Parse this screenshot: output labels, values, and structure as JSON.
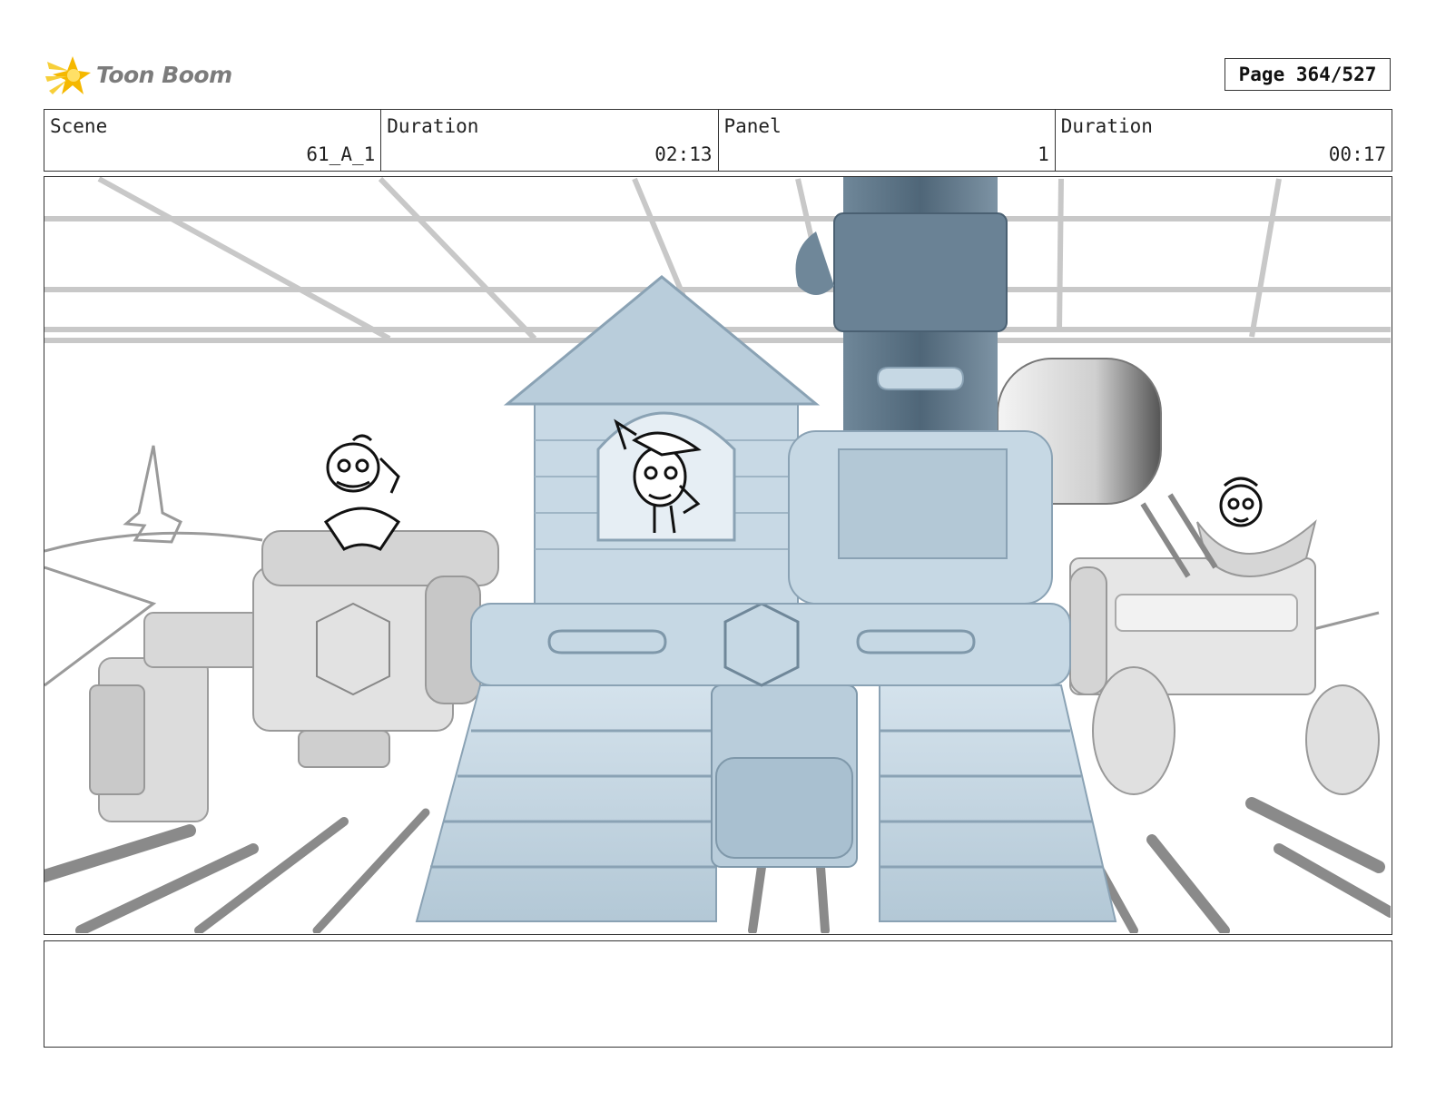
{
  "header": {
    "logo_text": "Toon Boom",
    "page_indicator": "Page 364/527"
  },
  "info": {
    "scene_label": "Scene",
    "scene_value": "61_A_1",
    "scene_duration_label": "Duration",
    "scene_duration_value": "02:13",
    "panel_label": "Panel",
    "panel_value": "1",
    "panel_duration_label": "Duration",
    "panel_duration_value": "00:17"
  },
  "notes": {
    "text": ""
  },
  "colors": {
    "vehicle_blue": "#c4d6e2",
    "vehicle_blue_dark": "#5b7385",
    "vehicle_gray": "#d6d6d6",
    "logo_yellow": "#f5c518",
    "border": "#333333"
  }
}
